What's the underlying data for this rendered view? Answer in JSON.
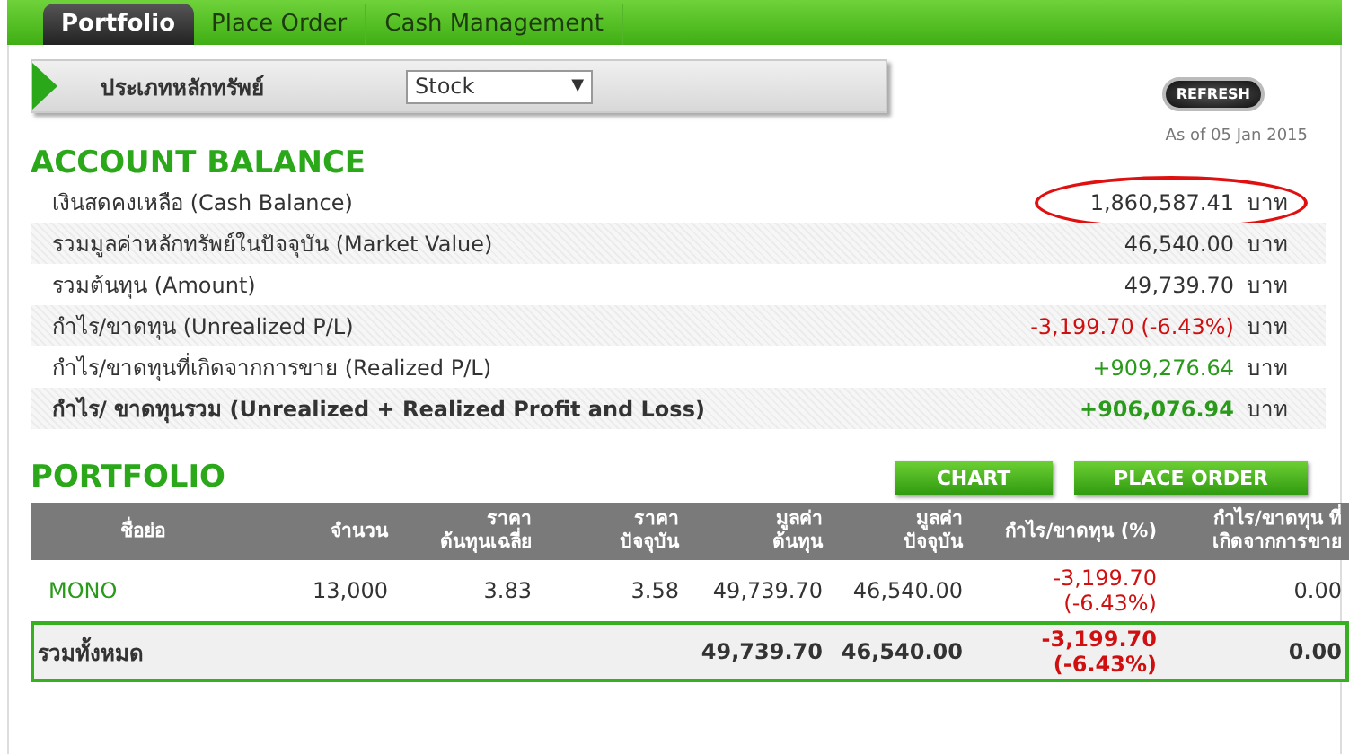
{
  "tabs": [
    {
      "label": "Portfolio",
      "selected": true
    },
    {
      "label": "Place Order",
      "selected": false
    },
    {
      "label": "Cash Management",
      "selected": false
    }
  ],
  "filter": {
    "label": "ประเภทหลักทรัพย์",
    "value": "Stock",
    "arrow": "▼"
  },
  "refresh_button": "REFRESH",
  "as_of": "As of 05 Jan 2015",
  "account_balance": {
    "title": "ACCOUNT BALANCE",
    "rows": [
      {
        "label": "เงินสดคงเหลือ (Cash Balance)",
        "value": "1,860,587.41",
        "unit": "บาท",
        "kind": "plain",
        "highlighted": true
      },
      {
        "label": "รวมมูลค่าหลักทรัพย์ในปัจจุบัน (Market Value)",
        "value": "46,540.00",
        "unit": "บาท",
        "kind": "plain",
        "highlighted": false
      },
      {
        "label": "รวมต้นทุน (Amount)",
        "value": "49,739.70",
        "unit": "บาท",
        "kind": "plain",
        "highlighted": false
      },
      {
        "label": "กำไร/ขาดทุน (Unrealized P/L)",
        "value": "-3,199.70 (-6.43%)",
        "unit": "บาท",
        "kind": "loss",
        "highlighted": false
      },
      {
        "label": "กำไร/ขาดทุนที่เกิดจากการขาย (Realized P/L)",
        "value": "+909,276.64",
        "unit": "บาท",
        "kind": "gain",
        "highlighted": false
      },
      {
        "label": "กำไร/ ขาดทุนรวม (Unrealized + Realized Profit and Loss)",
        "value": "+906,076.94",
        "unit": "บาท",
        "kind": "total",
        "highlighted": false
      }
    ]
  },
  "portfolio": {
    "title": "PORTFOLIO",
    "buttons": [
      "CHART",
      "PLACE ORDER"
    ],
    "columns": [
      [
        "ชื่อย่อ"
      ],
      [
        "จำนวน"
      ],
      [
        "ราคา",
        "ต้นทุนเฉลี่ย"
      ],
      [
        "ราคา",
        "ปัจจุบัน"
      ],
      [
        "มูลค่า",
        "ต้นทุน"
      ],
      [
        "มูลค่า",
        "ปัจจุบัน"
      ],
      [
        "กำไร/ขาดทุน (%)"
      ],
      [
        "กำไร/ขาดทุน ที่",
        "เกิดจากการขาย"
      ]
    ],
    "rows": [
      {
        "symbol": "MONO",
        "quantity": "13,000",
        "avg_cost": "3.83",
        "price": "3.58",
        "cost_value": "49,739.70",
        "market_value": "46,540.00",
        "pl": [
          "-3,199.70",
          "(-6.43%)"
        ],
        "realized": "0.00"
      }
    ],
    "total": {
      "label": "รวมทั้งหมด",
      "cost_value": "49,739.70",
      "market_value": "46,540.00",
      "pl": [
        "-3,199.70",
        "(-6.43%)"
      ],
      "realized": "0.00"
    }
  }
}
